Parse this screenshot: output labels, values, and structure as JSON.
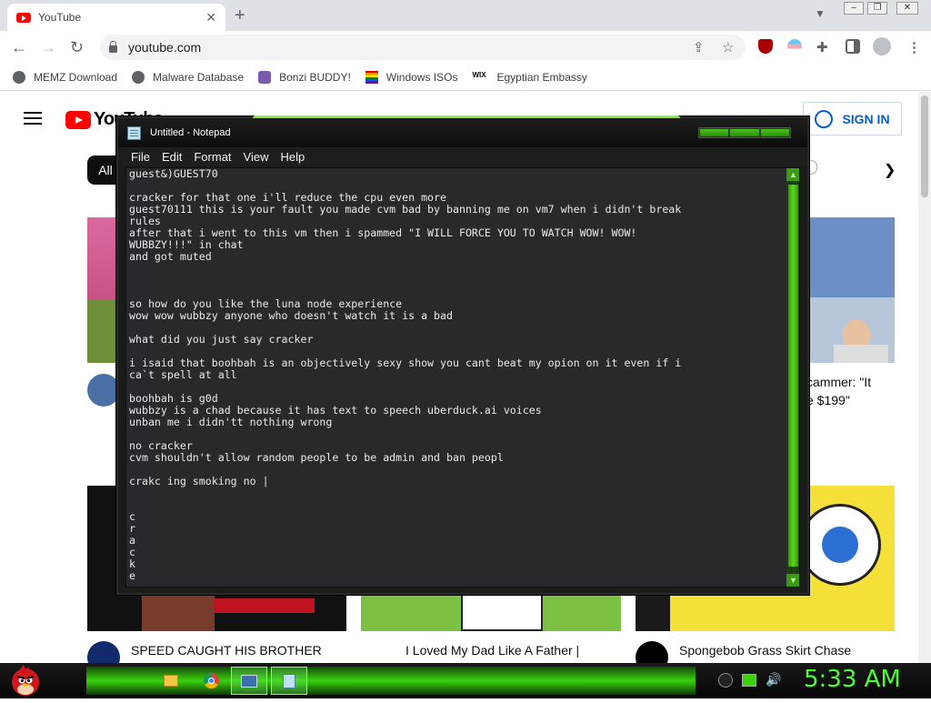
{
  "browser": {
    "tab_title": "YouTube",
    "url": "youtube.com",
    "bookmarks": [
      {
        "label": "MEMZ Download",
        "icon": "globe-icon"
      },
      {
        "label": "Malware Database",
        "icon": "globe-icon"
      },
      {
        "label": "Bonzi BUDDY!",
        "icon": "bonzi-icon"
      },
      {
        "label": "Windows ISOs",
        "icon": "windows-logo-icon"
      },
      {
        "label": "Egyptian Embassy",
        "icon": "wix-icon"
      }
    ]
  },
  "youtube": {
    "sign_in_label": "SIGN IN",
    "chip_all": "All",
    "visible_title_fragments": [
      "cammer: \"It",
      "e $199\""
    ],
    "videos_bottom": [
      {
        "title": "SPEED CAUGHT HIS BROTHER"
      },
      {
        "title": "I Loved My Dad Like A Father |"
      },
      {
        "title": "Spongebob Grass Skirt Chase"
      }
    ]
  },
  "notepad": {
    "title": "Untitled - Notepad",
    "menu": [
      "File",
      "Edit",
      "Format",
      "View",
      "Help"
    ],
    "text": "guest&)GUEST70\n\ncracker for that one i'll reduce the cpu even more\nguest70111 this is your fault you made cvm bad by banning me on vm7 when i didn't break\nrules\nafter that i went to this vm then i spammed \"I WILL FORCE YOU TO WATCH WOW! WOW!\nWUBBZY!!!\" in chat\nand got muted\n\n\n\nso how do you like the luna node experience\nwow wow wubbzy anyone who doesn't watch it is a bad\n\nwhat did you just say cracker\n\ni isaid that boohbah is an objectively sexy show you cant beat my opion on it even if i\nca`t spell at all\n\nboohbah is g0d\nwubbzy is a chad because it has text to speech uberduck.ai voices\nunban me i didn'tt nothing wrong\n\nno cracker\ncvm shouldn't allow random people to be admin and ban peopl\n\ncrakc ing smoking no |\n\n\nc\nr\na\nc\nk\ne"
  },
  "taskbar": {
    "clock": "5:33 AM"
  },
  "colors": {
    "accent_green": "#4bff34",
    "youtube_red": "#ff0000",
    "signin_blue": "#065fd4"
  }
}
